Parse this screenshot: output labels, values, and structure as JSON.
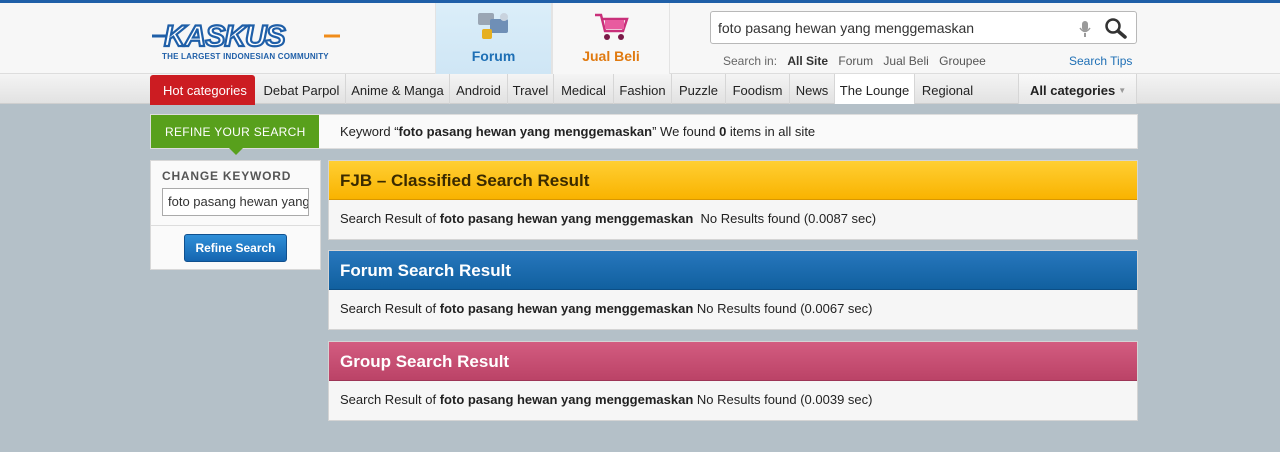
{
  "header": {
    "logo_text": "KASKUS",
    "tagline": "THE LARGEST INDONESIAN COMMUNITY",
    "tabs": [
      {
        "label": "Forum",
        "icon": "forum-icon",
        "active": true
      },
      {
        "label": "Jual Beli",
        "icon": "shopping-cart-icon",
        "active": false
      }
    ],
    "search": {
      "value": "foto pasang hewan yang menggemaskan",
      "in_label": "Search in:",
      "options": [
        "All Site",
        "Forum",
        "Jual Beli",
        "Groupee"
      ],
      "selected": "All Site",
      "tips": "Search Tips"
    }
  },
  "nav": {
    "hot": "Hot categories",
    "items": [
      "Debat Parpol",
      "Anime & Manga",
      "Android",
      "Travel",
      "Medical",
      "Fashion",
      "Puzzle",
      "Foodism",
      "News",
      "The Lounge",
      "Regional"
    ],
    "active": "The Lounge",
    "all": "All categories"
  },
  "refine": {
    "label": "REFINE YOUR SEARCH",
    "msg_prefix": "Keyword “",
    "keyword": "foto pasang hewan yang menggemaskan",
    "msg_mid": "” We found ",
    "count": "0",
    "msg_suffix": " items in all site"
  },
  "sidebar": {
    "title": "CHANGE KEYWORD",
    "input_value": "foto pasang hewan yang menggemaskan",
    "button": "Refine Search"
  },
  "results": [
    {
      "title": "FJB – Classified Search Result",
      "prefix": "Search Result of ",
      "keyword": "foto pasang hewan yang menggemaskan",
      "status": "  No Results found (0.0087 sec)",
      "color": "#f9b300"
    },
    {
      "title": "Forum Search Result",
      "prefix": "Search Result of ",
      "keyword": "foto pasang hewan yang menggemaskan",
      "status": " No Results found (0.0067 sec)",
      "color": "#11609f"
    },
    {
      "title": "Group Search Result",
      "prefix": "Search Result of ",
      "keyword": "foto pasang hewan yang menggemaskan",
      "status": " No Results found (0.0039 sec)",
      "color": "#bb4367"
    }
  ],
  "colors": {
    "hot": "#cc1c22",
    "refine": "#58a01c",
    "link": "#1e6fb5",
    "background": "#b4c0c8"
  }
}
